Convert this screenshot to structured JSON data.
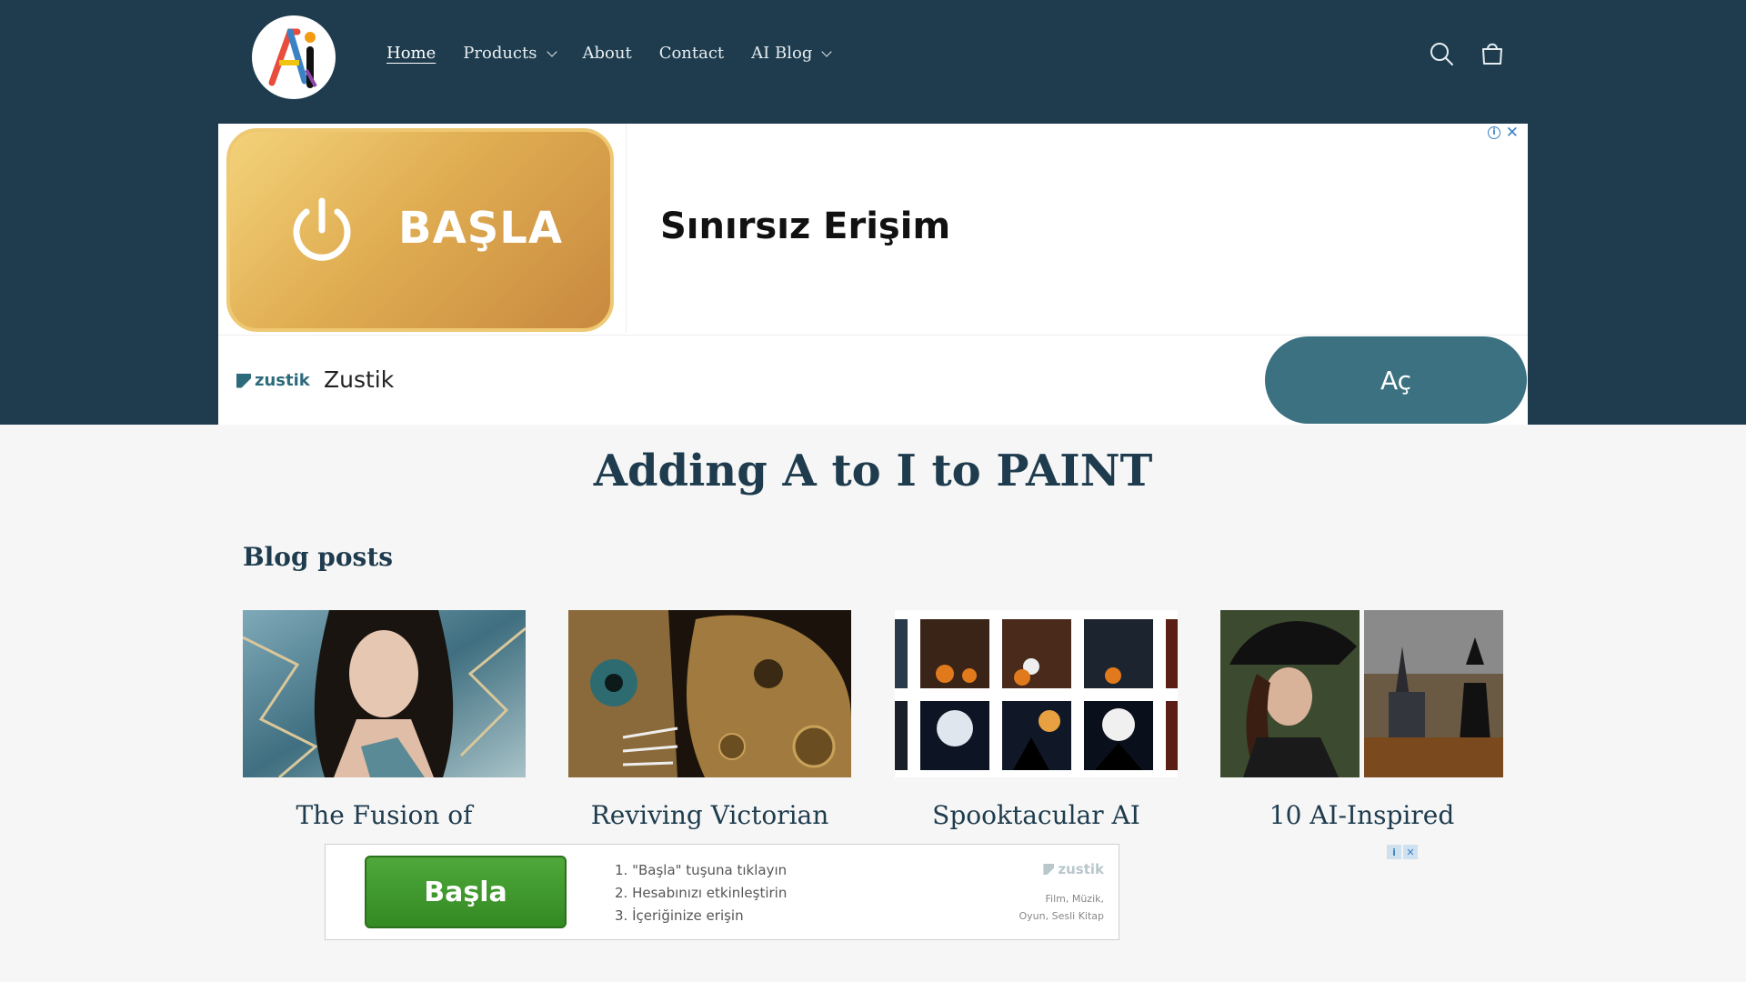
{
  "header": {
    "nav": [
      {
        "label": "Home",
        "dropdown": false,
        "active": true
      },
      {
        "label": "Products",
        "dropdown": true,
        "active": false
      },
      {
        "label": "About",
        "dropdown": false,
        "active": false
      },
      {
        "label": "Contact",
        "dropdown": false,
        "active": false
      },
      {
        "label": "AI Blog",
        "dropdown": true,
        "active": false
      }
    ],
    "icons": [
      "search-icon",
      "cart-icon"
    ],
    "logo_text": "Ai"
  },
  "ad_top": {
    "start_label": "BAŞLA",
    "headline": "Sınırsız Erişim",
    "brand_logo": "zustik",
    "brand_name": "Zustik",
    "open_label": "Aç",
    "info": "i",
    "close": "✕"
  },
  "main": {
    "headline_parts": [
      "Adding ",
      "A",
      " to ",
      "I",
      " to PA",
      "I",
      "NT"
    ],
    "section_title": "Blog posts",
    "posts": [
      {
        "title": "The Fusion of",
        "thumb": "portrait"
      },
      {
        "title": "Reviving Victorian",
        "thumb": "steampunk-tigers"
      },
      {
        "title": "Spooktacular AI",
        "thumb": "halloween-grid"
      },
      {
        "title": "10 AI-Inspired",
        "thumb": "witches"
      }
    ]
  },
  "ad_bottom": {
    "button_label": "Başla",
    "steps": [
      "1. \"Başla\" tuşuna tıklayın",
      "2. Hesabınızı etkinleştirin",
      "3. İçeriğinize erişin"
    ],
    "brand": "zustik",
    "categories": [
      "Film, Müzik,",
      "Oyun, Sesli Kitap"
    ],
    "info": "i",
    "close": "✕"
  },
  "colors": {
    "header_bg": "#1e3c4e",
    "page_bg": "#f6f6f6",
    "accent_teal": "#3b7180",
    "gold": "#e0ad52",
    "green": "#338a23"
  }
}
